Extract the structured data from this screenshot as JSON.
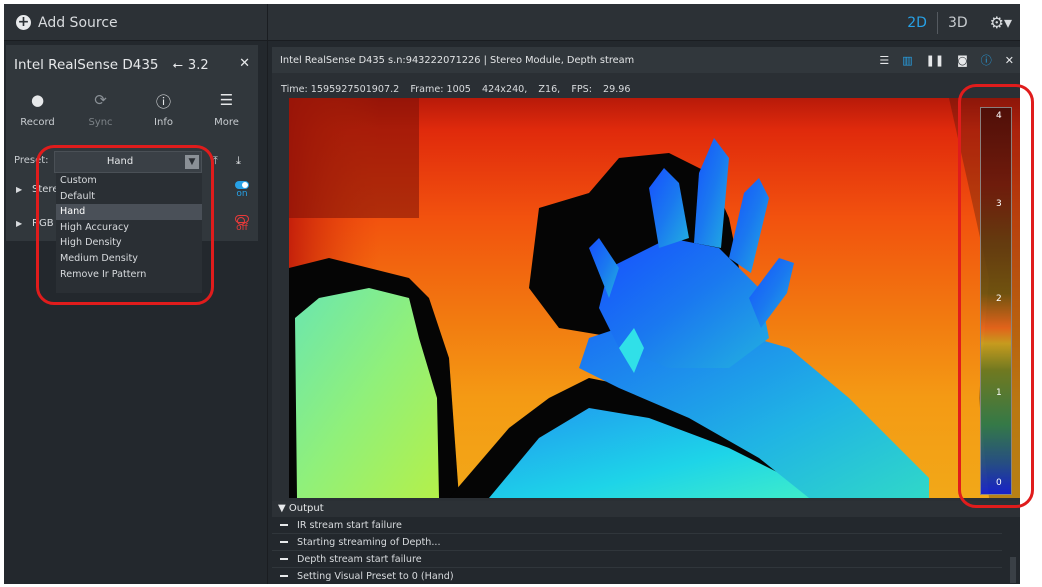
{
  "topbar": {
    "add_source_label": "Add Source",
    "view_2d": "2D",
    "view_3d": "3D"
  },
  "device": {
    "name": "Intel RealSense D435",
    "usb_version": "3.2",
    "actions": [
      {
        "label": "Record",
        "icon": "record-icon"
      },
      {
        "label": "Sync",
        "icon": "sync-icon"
      },
      {
        "label": "Info",
        "icon": "info-icon"
      },
      {
        "label": "More",
        "icon": "menu-icon"
      }
    ],
    "preset_label": "Preset:",
    "preset_value": "Hand",
    "preset_options": [
      "Custom",
      "Default",
      "Hand",
      "High Accuracy",
      "High Density",
      "Medium Density",
      "Remove Ir Pattern"
    ],
    "sensors": [
      {
        "name": "Stere",
        "state": "on"
      },
      {
        "name": "RGB",
        "state": "off"
      }
    ]
  },
  "viewer": {
    "title": "Intel RealSense D435 s.n:943222071226 | Stereo Module, Depth stream",
    "stats": {
      "time": "Time: 1595927501907.2",
      "frame": "Frame: 1005",
      "resolution": "424x240,",
      "format": "Z16,",
      "fps_label": "FPS:",
      "fps_value": "29.96"
    },
    "colorbar_ticks": [
      "4",
      "3",
      "2",
      "1",
      "0"
    ],
    "colormap": {
      "near": "#0a14e0",
      "far": "#e01a0a"
    }
  },
  "output": {
    "header": "Output",
    "logs": [
      "IR stream start failure",
      "Starting streaming of Depth...",
      "Depth stream start failure",
      "Setting Visual Preset to 0 (Hand)"
    ]
  },
  "colors": {
    "accent": "#27a1e6",
    "off": "#e83a3a",
    "annotation": "#e01c1c"
  }
}
